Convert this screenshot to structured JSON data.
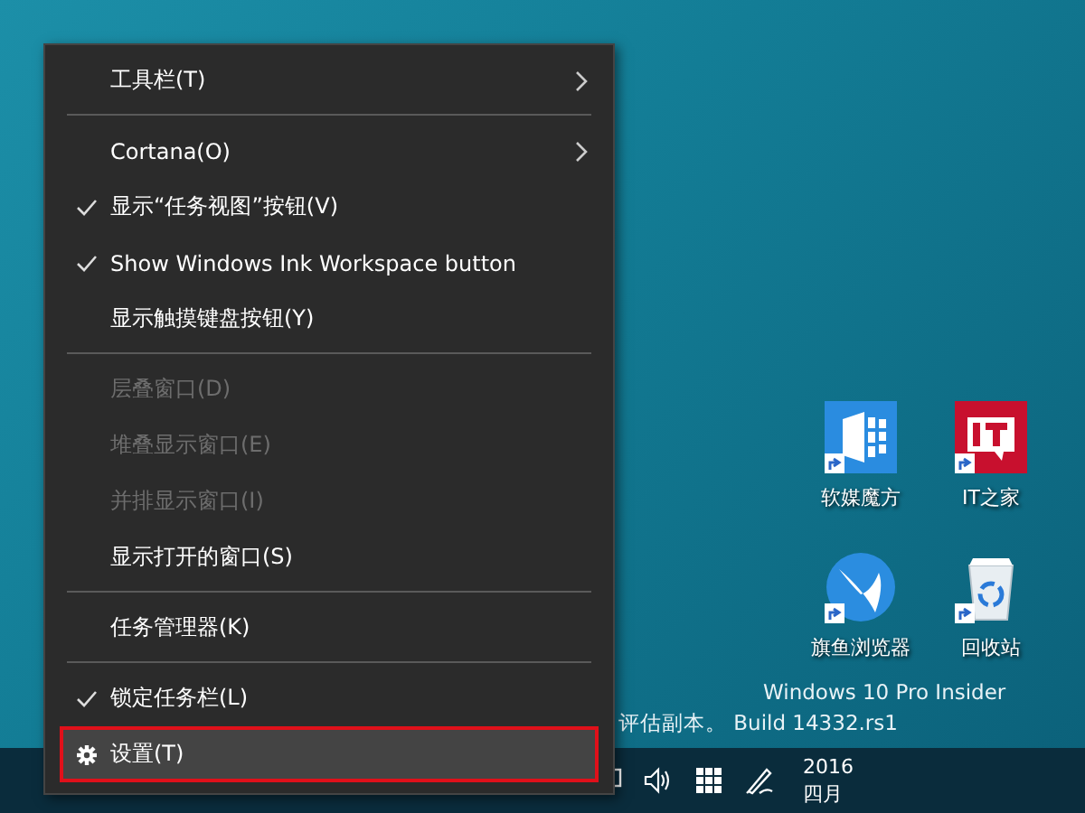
{
  "context_menu": {
    "items": [
      {
        "kind": "item",
        "label": "工具栏(T)",
        "checked": false,
        "disabled": false,
        "submenu": true,
        "selected": false
      },
      {
        "kind": "separator"
      },
      {
        "kind": "item",
        "label": "Cortana(O)",
        "checked": false,
        "disabled": false,
        "submenu": true,
        "selected": false
      },
      {
        "kind": "item",
        "label": "显示“任务视图”按钮(V)",
        "checked": true,
        "disabled": false,
        "submenu": false,
        "selected": false
      },
      {
        "kind": "item",
        "label": "Show Windows Ink Workspace button",
        "checked": true,
        "disabled": false,
        "submenu": false,
        "selected": false
      },
      {
        "kind": "item",
        "label": "显示触摸键盘按钮(Y)",
        "checked": false,
        "disabled": false,
        "submenu": false,
        "selected": false
      },
      {
        "kind": "separator"
      },
      {
        "kind": "item",
        "label": "层叠窗口(D)",
        "checked": false,
        "disabled": true,
        "submenu": false,
        "selected": false
      },
      {
        "kind": "item",
        "label": "堆叠显示窗口(E)",
        "checked": false,
        "disabled": true,
        "submenu": false,
        "selected": false
      },
      {
        "kind": "item",
        "label": "并排显示窗口(I)",
        "checked": false,
        "disabled": true,
        "submenu": false,
        "selected": false
      },
      {
        "kind": "item",
        "label": "显示打开的窗口(S)",
        "checked": false,
        "disabled": false,
        "submenu": false,
        "selected": false
      },
      {
        "kind": "separator"
      },
      {
        "kind": "item",
        "label": "任务管理器(K)",
        "checked": false,
        "disabled": false,
        "submenu": false,
        "selected": false
      },
      {
        "kind": "separator"
      },
      {
        "kind": "item",
        "label": "锁定任务栏(L)",
        "checked": true,
        "disabled": false,
        "submenu": false,
        "selected": false
      },
      {
        "kind": "settings",
        "label": "设置(T)",
        "checked": false,
        "disabled": false,
        "submenu": false,
        "selected": true
      }
    ]
  },
  "desktop_icons": [
    {
      "kind": "cube",
      "label": "软媒魔方"
    },
    {
      "kind": "it",
      "label": "IT之家"
    },
    {
      "kind": "browser",
      "label": "旗鱼浏览器"
    },
    {
      "kind": "bin",
      "label": "回收站"
    }
  ],
  "edition_text": [
    "Windows 10 Pro Insider",
    "评估副本。 Build 14332.rs1"
  ],
  "taskbar": {
    "clock": [
      "2016",
      "四月"
    ]
  }
}
